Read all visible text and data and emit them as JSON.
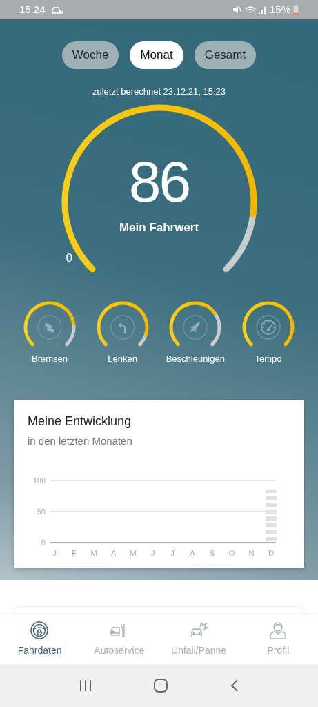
{
  "status_bar": {
    "time": "15:24",
    "battery": "15%"
  },
  "period_tabs": [
    {
      "label": "Woche",
      "selected": false
    },
    {
      "label": "Monat",
      "selected": true
    },
    {
      "label": "Gesamt",
      "selected": false
    }
  ],
  "last_calculated": "zuletzt berechnet 23.12.21, 15:23",
  "score": {
    "value": "86",
    "label": "Mein Fahrwert",
    "min_label": "0"
  },
  "categories": [
    {
      "label": "Bremsen"
    },
    {
      "label": "Lenken"
    },
    {
      "label": "Beschleunigen"
    },
    {
      "label": "Tempo"
    }
  ],
  "development": {
    "title": "Meine Entwicklung",
    "subtitle": "in den letzten Monaten",
    "chart_data": {
      "type": "bar",
      "categories": [
        "J",
        "F",
        "M",
        "A",
        "M",
        "J",
        "J",
        "A",
        "S",
        "O",
        "N",
        "D"
      ],
      "values": [
        null,
        null,
        null,
        null,
        null,
        null,
        null,
        null,
        null,
        null,
        null,
        86
      ],
      "ylim": [
        0,
        100
      ],
      "yticks": [
        0,
        50,
        100
      ]
    }
  },
  "bottom_nav": [
    {
      "label": "Fahrdaten",
      "selected": true
    },
    {
      "label": "Autoservice",
      "selected": false
    },
    {
      "label": "Unfall/Panne",
      "selected": false
    },
    {
      "label": "Profil",
      "selected": false
    }
  ]
}
